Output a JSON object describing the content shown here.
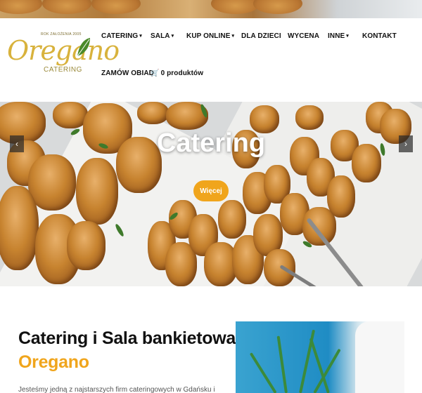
{
  "brand": {
    "established": "ROK ZAŁOŻENIA 2005",
    "name": "Oregano",
    "subtitle": "CATERING",
    "gold": "#d8b23c",
    "leaf_green": "#4a8a2a"
  },
  "nav": {
    "items": [
      {
        "label": "CATERING",
        "dropdown": true
      },
      {
        "label": "SALA",
        "dropdown": true
      },
      {
        "label": "KUP ONLINE",
        "dropdown": true
      },
      {
        "label": "DLA DZIECI",
        "dropdown": false
      },
      {
        "label": "WYCENA",
        "dropdown": false
      },
      {
        "label": "INNE",
        "dropdown": true
      },
      {
        "label": "KONTAKT",
        "dropdown": false
      },
      {
        "label": "ZAMÓW OBIAD",
        "dropdown": false
      }
    ],
    "cart_label": "0 produktów",
    "cart_icon": "shopping-cart-icon",
    "caret_icon": "chevron-down-icon"
  },
  "hero": {
    "title": "Catering",
    "button_label": "Więcej",
    "accent": "#f0a51c",
    "prev_icon": "chevron-left-icon",
    "next_icon": "chevron-right-icon"
  },
  "about": {
    "title": "Catering i Sala bankietowa",
    "name": "Oregano",
    "text": "Jesteśmy jedną z najstarszych firm cateringowych w Gdańsku i oferujemy"
  }
}
